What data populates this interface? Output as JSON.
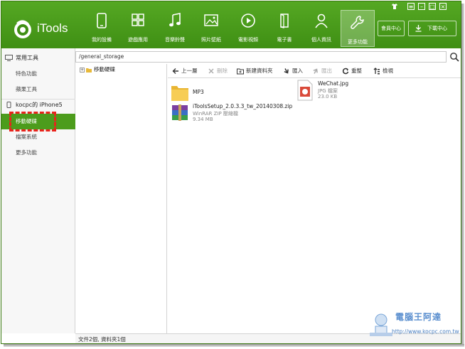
{
  "app": {
    "title": "iTools"
  },
  "header": {
    "nav": [
      {
        "id": "my-device",
        "label": "我的設備"
      },
      {
        "id": "games-apps",
        "label": "遊戲應用"
      },
      {
        "id": "music-ringtones",
        "label": "音樂鈴聲"
      },
      {
        "id": "photos-wallpapers",
        "label": "照片壁紙"
      },
      {
        "id": "videos",
        "label": "電影視頻"
      },
      {
        "id": "ebooks",
        "label": "電子書"
      },
      {
        "id": "personal-info",
        "label": "個人資訊"
      },
      {
        "id": "more-functions",
        "label": "更多功能"
      }
    ],
    "active_nav": "more-functions",
    "member_center": "會員中心",
    "download_center": "下載中心"
  },
  "sidebar": {
    "group_tools": {
      "label": "常用工具"
    },
    "tool_items": [
      {
        "label": "特色功能"
      },
      {
        "label": "蘋果工具"
      }
    ],
    "group_device": {
      "label": "kocpc的 iPhone5"
    },
    "device_items": [
      {
        "label": "移動硬碟",
        "active": true
      },
      {
        "label": "檔案系統"
      },
      {
        "label": "更多功能"
      }
    ]
  },
  "path": {
    "value": "/general_storage"
  },
  "tree": {
    "root": "移動硬碟"
  },
  "toolbar": {
    "back": "上一層",
    "delete": "刪除",
    "new_folder": "新建資料夾",
    "import": "匯入",
    "export": "匯出",
    "refresh": "重整",
    "view": "檢視"
  },
  "files": [
    {
      "name": "MP3",
      "type": "",
      "size": "",
      "kind": "folder"
    },
    {
      "name": "WeChat.jpg",
      "type": "JPG 檔案",
      "size": "23.0 KB",
      "kind": "jpg"
    },
    {
      "name": "iToolsSetup_2.0.3.3_tw_20140308.zip",
      "type": "WinRAR ZIP 壓縮檔",
      "size": "9.34 MB",
      "kind": "zip"
    }
  ],
  "status": {
    "text": "文件2個, 資料夾1個"
  },
  "watermark": {
    "text": "電腦王阿達",
    "url": "http://www.kocpc.com.tw"
  },
  "colors": {
    "brand_green": "#4a9d1c",
    "highlight_red": "#e8241c"
  }
}
